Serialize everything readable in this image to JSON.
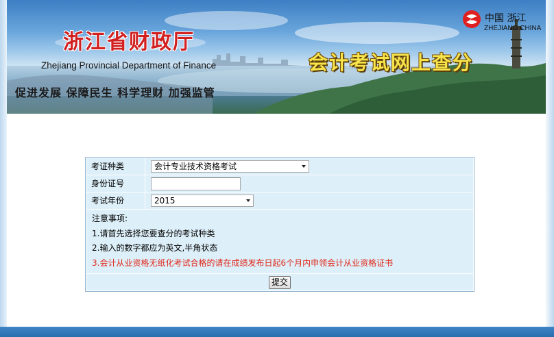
{
  "banner": {
    "title_cn": "浙江省财政厅",
    "title_en": "Zhejiang Provincial Department of Finance",
    "slogan": "促进发展 保障民生 科学理财 加强监管",
    "system_title": "会计考试网上查分",
    "logo": {
      "cn": "中国 浙江",
      "en": "ZHEJIANG CHINA",
      "icon": "zhejiang-logo-icon"
    }
  },
  "form": {
    "exam_type": {
      "label": "考证种类",
      "value": "会计专业技术资格考试"
    },
    "id_number": {
      "label": "身份证号",
      "value": ""
    },
    "exam_year": {
      "label": "考试年份",
      "value": "2015"
    },
    "notes": {
      "heading": "注意事项:",
      "items": [
        "1.请首先选择您要查分的考试种类",
        "2.输入的数字都应为英文,半角状态",
        "3.会计从业资格无纸化考试合格的请在成绩发布日起6个月内申领会计从业资格证书"
      ]
    },
    "submit_label": "提交"
  },
  "colors": {
    "title_red": "#d21f1f",
    "system_title_yellow": "#f7e34a",
    "form_bg": "#ddeff8",
    "form_border": "#8fb3d3",
    "note_red": "#e0281c",
    "footer_blue": "#2a6eae"
  }
}
